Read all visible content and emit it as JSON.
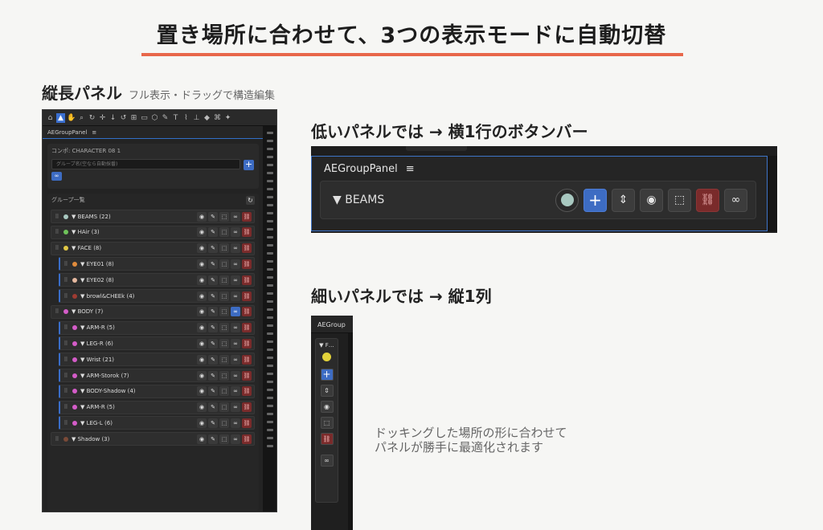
{
  "title": "置き場所に合わせて、3つの表示モードに自動切替",
  "sections": {
    "vertical": {
      "title": "縦長パネル",
      "subtitle": "フル表示・ドラッグで構造編集"
    },
    "horizontal": {
      "title": "低いパネルでは → 横1行のボタンバー"
    },
    "narrow": {
      "title": "細いパネルでは → 縦1列"
    }
  },
  "description": "ドッキングした場所の形に合わせて\nパネルが勝手に最適化されます",
  "vpanel": {
    "tab": "AEGroupPanel",
    "menu_icon": "≡",
    "comp_label": "コンポ: CHARACTER 08 1",
    "group_placeholder": "グループ名(空なら自動採番)",
    "list_title": "グループ一覧",
    "rows": [
      {
        "label": "▼ BEAMS (22)",
        "color": "#a8c8c0",
        "indent": 0
      },
      {
        "label": "▼ HAir (3)",
        "color": "#6fc35a",
        "indent": 0
      },
      {
        "label": "▼ FACE (8)",
        "color": "#e2c845",
        "indent": 0
      },
      {
        "label": "▼ EYE01 (8)",
        "color": "#e08b3c",
        "indent": 1
      },
      {
        "label": "▼ EYE02 (8)",
        "color": "#e6b9a0",
        "indent": 1
      },
      {
        "label": "▼ browl&CHEEk (4)",
        "color": "#9e3b32",
        "indent": 1
      },
      {
        "label": "▼ BODY (7)",
        "color": "#d45cc8",
        "indent": 0
      },
      {
        "label": "▼ ARM-R (5)",
        "color": "#d45cc8",
        "indent": 1
      },
      {
        "label": "▼ LEG-R (6)",
        "color": "#d45cc8",
        "indent": 1
      },
      {
        "label": "▼ Wrist (21)",
        "color": "#d45cc8",
        "indent": 1
      },
      {
        "label": "▼ ARM-Storok (7)",
        "color": "#d45cc8",
        "indent": 1
      },
      {
        "label": "▼ BODY-Shadow (4)",
        "color": "#d45cc8",
        "indent": 1
      },
      {
        "label": "▼ ARM-R (5)",
        "color": "#d45cc8",
        "indent": 1
      },
      {
        "label": "▼ LEG-L (6)",
        "color": "#d45cc8",
        "indent": 1
      },
      {
        "label": "▼ Shadow (3)",
        "color": "#7a4a38",
        "indent": 0
      }
    ]
  },
  "hpanel": {
    "tab": "AEGroupPanel",
    "menu_icon": "≡",
    "group_label": "▼ BEAMS",
    "swatch_color": "#a8c8c0"
  },
  "npanel": {
    "tab": "AEGroup",
    "group_label": "▼ F…",
    "swatch_color": "#e2d23a"
  },
  "colors": {
    "accent": "#e8674a",
    "blue": "#3d6cc3",
    "red": "#7a2b2b"
  }
}
